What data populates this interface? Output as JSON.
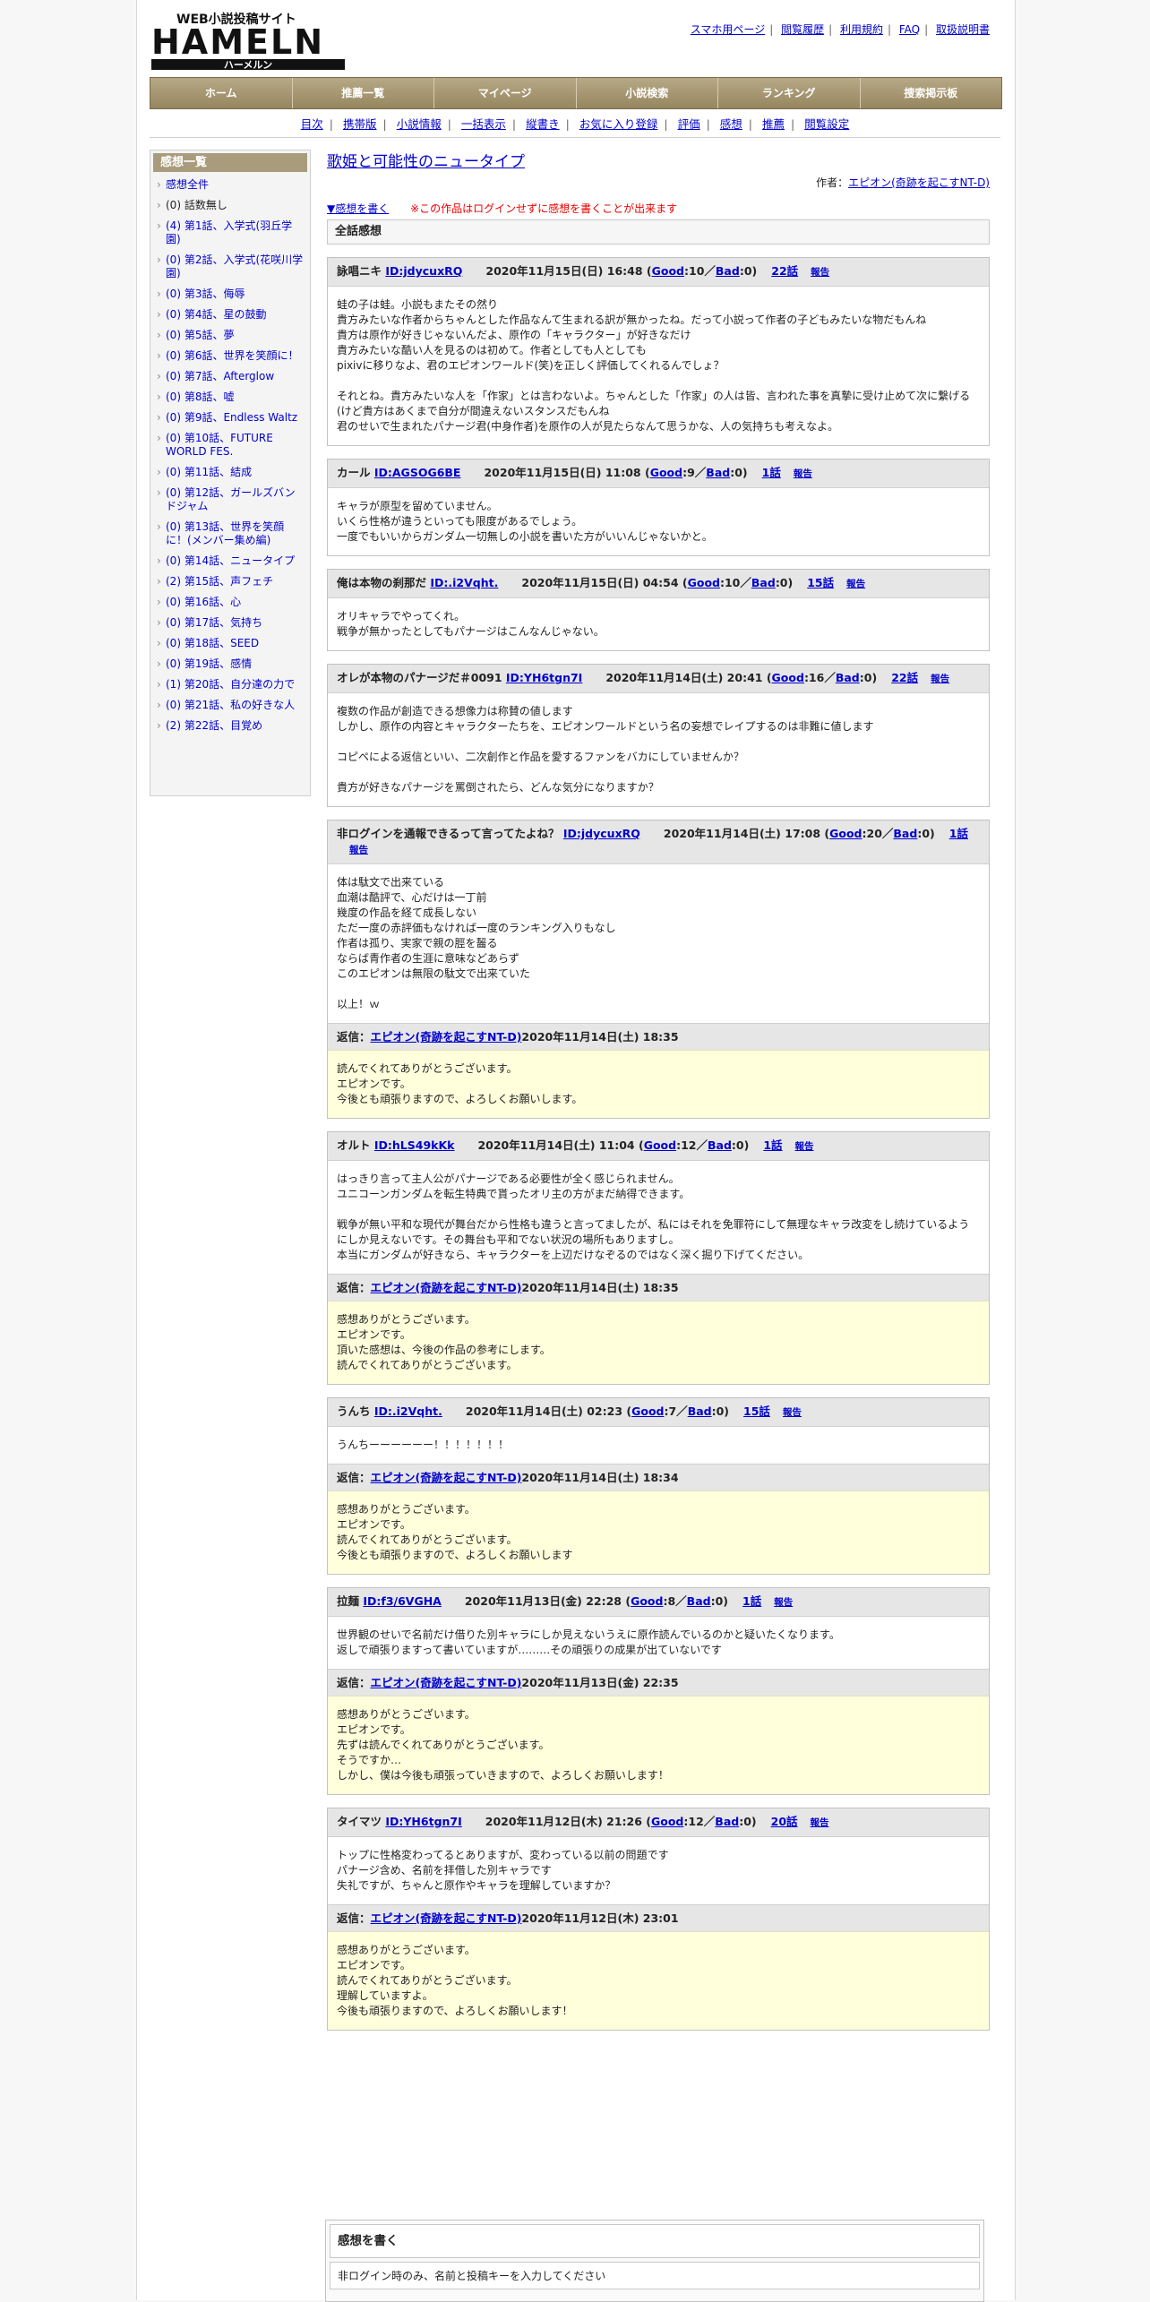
{
  "site": {
    "logo_text": "HAMELN",
    "logo_sub": "WEB小説投稿サイト",
    "logo_kana": "ハーメルン"
  },
  "toplinks": [
    "スマホ用ページ",
    "閲覧履歴",
    "利用規約",
    "FAQ",
    "取扱説明書"
  ],
  "gnav": [
    "ホーム",
    "推薦一覧",
    "マイページ",
    "小説検索",
    "ランキング",
    "捜索掲示板"
  ],
  "subnav": [
    "目次",
    "携帯版",
    "小説情報",
    "一括表示",
    "縦書き",
    "お気に入り登録",
    "評価",
    "感想",
    "推薦",
    "閲覧設定"
  ],
  "sidebar": {
    "title": "感想一覧",
    "items": [
      "感想全件",
      "(0) 話数無し",
      "(4) 第1話、入学式(羽丘学園)",
      "(0) 第2話、入学式(花咲川学園)",
      "(0) 第3話、侮辱",
      "(0) 第4話、星の鼓動",
      "(0) 第5話、夢",
      "(0) 第6話、世界を笑顔に！",
      "(0) 第7話、Afterglow",
      "(0) 第8話、嘘",
      "(0) 第9話、Endless Waltz",
      "(0) 第10話、FUTURE WORLD FES.",
      "(0) 第11話、結成",
      "(0) 第12話、ガールズバンドジャム",
      "(0) 第13話、世界を笑顔に！(メンバー集め編)",
      "(0) 第14話、ニュータイプ",
      "(2) 第15話、声フェチ",
      "(0) 第16話、心",
      "(0) 第17話、気持ち",
      "(0) 第18話、SEED",
      "(0) 第19話、感情",
      "(1) 第20話、自分達の力で",
      "(0) 第21話、私の好きな人",
      "(2) 第22話、目覚め"
    ]
  },
  "main": {
    "title": "歌姫と可能性のニュータイプ",
    "author_label": "作者：",
    "author": "エピオン(奇跡を起こすNT-D)",
    "write_link": "▼感想を書く",
    "login_note": "※この作品はログインせずに感想を書くことが出来ます",
    "all_label": "全話感想",
    "good_label": "Good",
    "bad_label": "Bad",
    "report_label": "報告",
    "reply_label": "返信："
  },
  "reviews": [
    {
      "name": "詠唱ニキ",
      "id": "ID:jdycuxRQ",
      "date": "2020年11月15日(日) 16:48",
      "good": "10",
      "bad": "0",
      "chapter": "22話",
      "body": "蛙の子は蛙。小説もまたその然り\n貴方みたいな作者からちゃんとした作品なんて生まれる訳が無かったね。だって小説って作者の子どもみたいな物だもんね\n貴方は原作が好きじゃないんだよ、原作の「キャラクター」が好きなだけ\n貴方みたいな酷い人を見るのは初めて。作者としても人としても\npixivに移りなよ、君のエピオンワールド(笑)を正しく評価してくれるんでしょ？\n\nそれとね。貴方みたいな人を「作家」とは言わないよ。ちゃんとした「作家」の人は皆、言われた事を真摯に受け止めて次に繋げる(けど貴方はあくまで自分が間違えないスタンスだもんね\n君のせいで生まれたパナージ君(中身作者)を原作の人が見たらなんて思うかな、人の気持ちも考えなよ。"
    },
    {
      "name": "カール",
      "id": "ID:AGSOG6BE",
      "date": "2020年11月15日(日) 11:08",
      "good": "9",
      "bad": "0",
      "chapter": "1話",
      "body": "キャラが原型を留めていません。\nいくら性格が違うといっても限度があるでしょう。\n一度でもいいからガンダム一切無しの小説を書いた方がいいんじゃないかと。"
    },
    {
      "name": "俺は本物の刹那だ",
      "id": "ID:.i2Vqht.",
      "date": "2020年11月15日(日) 04:54",
      "good": "10",
      "bad": "0",
      "chapter": "15話",
      "body": "オリキャラでやってくれ。\n戦争が無かったとしてもパナージはこんなんじゃない。"
    },
    {
      "name": "オレが本物のパナージだ＃0091",
      "id": "ID:YH6tgn7I",
      "date": "2020年11月14日(土) 20:41",
      "good": "16",
      "bad": "0",
      "chapter": "22話",
      "body": "複数の作品が創造できる想像力は称賛の値します\nしかし、原作の内容とキャラクターたちを、エピオンワールドという名の妄想でレイプするのは非難に値します\n\nコピペによる返信といい、二次創作と作品を愛するファンをバカにしていませんか？\n\n貴方が好きなパナージを罵倒されたら、どんな気分になりますか？"
    },
    {
      "name": "非ログインを通報できるって言ってたよね？",
      "id": "ID:jdycuxRQ",
      "date": "2020年11月14日(土) 17:08",
      "good": "20",
      "bad": "0",
      "chapter": "1話",
      "body": "体は駄文で出来ている\n血潮は酷評で、心だけは一丁前\n幾度の作品を経て成長しない\nただ一度の赤評価もなければ一度のランキング入りもなし\n作者は孤り、実家で親の脛を齧る\nならば青作者の生涯に意味などあらず\nこのエピオンは無限の駄文で出来ていた\n\n以上！ｗ",
      "reply": {
        "author": "エピオン(奇跡を起こすNT-D)",
        "date": "2020年11月14日(土) 18:35",
        "body": "読んでくれてありがとうございます。\nエピオンです。\n今後とも頑張りますので、よろしくお願いします。"
      }
    },
    {
      "name": "オルト",
      "id": "ID:hLS49kKk",
      "date": "2020年11月14日(土) 11:04",
      "good": "12",
      "bad": "0",
      "chapter": "1話",
      "body": "はっきり言って主人公がパナージである必要性が全く感じられません。\nユニコーンガンダムを転生特典で貰ったオリ主の方がまだ納得できます。\n\n戦争が無い平和な現代が舞台だから性格も違うと言ってましたが、私にはそれを免罪符にして無理なキャラ改変をし続けているようにしか見えないです。その舞台も平和でない状況の場所もありますし。\n本当にガンダムが好きなら、キャラクターを上辺だけなぞるのではなく深く掘り下げてください。",
      "reply": {
        "author": "エピオン(奇跡を起こすNT-D)",
        "date": "2020年11月14日(土) 18:35",
        "body": "感想ありがとうございます。\nエピオンです。\n頂いた感想は、今後の作品の参考にします。\n読んでくれてありがとうございます。"
      }
    },
    {
      "name": "うんち",
      "id": "ID:.i2Vqht.",
      "date": "2020年11月14日(土) 02:23",
      "good": "7",
      "bad": "0",
      "chapter": "15話",
      "body": "うんちーーーーーー！！！！！！！",
      "reply": {
        "author": "エピオン(奇跡を起こすNT-D)",
        "date": "2020年11月14日(土) 18:34",
        "body": "感想ありがとうございます。\nエピオンです。\n読んでくれてありがとうございます。\n今後とも頑張りますので、よろしくお願いします"
      }
    },
    {
      "name": "拉麺",
      "id": "ID:f3/6VGHA",
      "date": "2020年11月13日(金) 22:28",
      "good": "8",
      "bad": "0",
      "chapter": "1話",
      "body": "世界観のせいで名前だけ借りた別キャラにしか見えないうえに原作読んでいるのかと疑いたくなります。\n返しで頑張りますって書いていますが………その頑張りの成果が出ていないです",
      "reply": {
        "author": "エピオン(奇跡を起こすNT-D)",
        "date": "2020年11月13日(金) 22:35",
        "body": "感想ありがとうございます。\nエピオンです。\n先ずは読んでくれてありがとうございます。\nそうですか…\nしかし、僕は今後も頑張っていきますので、よろしくお願いします！"
      }
    },
    {
      "name": "タイマツ",
      "id": "ID:YH6tgn7I",
      "date": "2020年11月12日(木) 21:26",
      "good": "12",
      "bad": "0",
      "chapter": "20話",
      "body": "トップに性格変わってるとありますが、変わっている以前の問題です\nパナージ含め、名前を拝借した別キャラです\n失礼ですが、ちゃんと原作やキャラを理解していますか？",
      "reply": {
        "author": "エピオン(奇跡を起こすNT-D)",
        "date": "2020年11月12日(木) 23:01",
        "body": "感想ありがとうございます。\nエピオンです。\n読んでくれてありがとうございます。\n理解していますよ。\n今後も頑張りますので、よろしくお願いします！"
      }
    }
  ],
  "write_box": {
    "title": "感想を書く",
    "note": "非ログイン時のみ、名前と投稿キーを入力してください"
  }
}
